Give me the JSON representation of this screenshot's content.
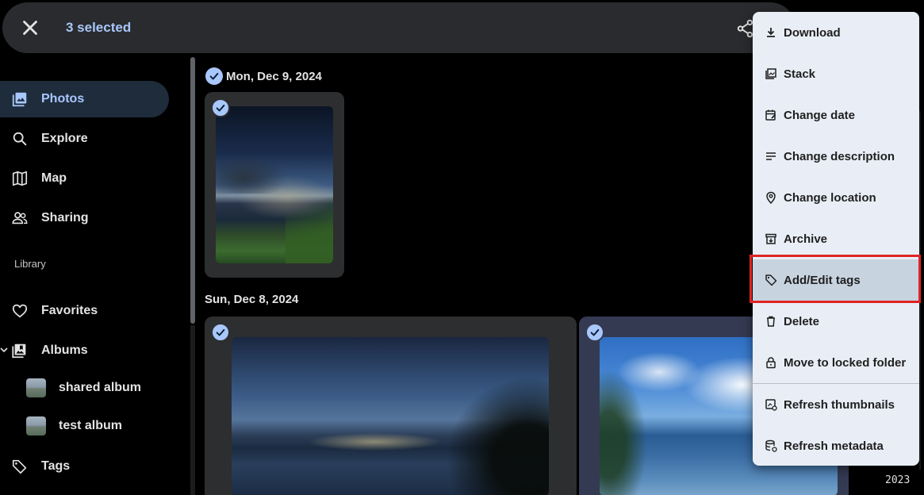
{
  "topbar": {
    "selected_text": "3 selected"
  },
  "sidebar": {
    "items": [
      {
        "label": "Photos",
        "icon": "photos-icon",
        "active": true
      },
      {
        "label": "Explore",
        "icon": "search-icon"
      },
      {
        "label": "Map",
        "icon": "map-icon"
      },
      {
        "label": "Sharing",
        "icon": "people-icon"
      }
    ],
    "library_label": "Library",
    "library_items": [
      {
        "label": "Favorites",
        "icon": "heart-icon"
      },
      {
        "label": "Albums",
        "icon": "album-icon"
      }
    ],
    "albums": [
      {
        "label": "shared album"
      },
      {
        "label": "test album"
      }
    ],
    "tags_label": "Tags"
  },
  "content": {
    "groups": [
      {
        "date": "Mon, Dec 9, 2024"
      },
      {
        "date": "Sun, Dec 8, 2024"
      }
    ]
  },
  "menu": {
    "items": [
      {
        "label": "Download",
        "icon": "download-icon"
      },
      {
        "label": "Stack",
        "icon": "stack-icon"
      },
      {
        "label": "Change date",
        "icon": "calendar-edit-icon"
      },
      {
        "label": "Change description",
        "icon": "description-icon"
      },
      {
        "label": "Change location",
        "icon": "location-icon"
      },
      {
        "label": "Archive",
        "icon": "archive-icon"
      },
      {
        "label": "Add/Edit tags",
        "icon": "tag-icon",
        "highlighted": true
      },
      {
        "label": "Delete",
        "icon": "trash-icon"
      },
      {
        "label": "Move to locked folder",
        "icon": "lock-icon"
      },
      {
        "label": "Refresh thumbnails",
        "icon": "refresh-thumbnails-icon"
      },
      {
        "label": "Refresh metadata",
        "icon": "refresh-metadata-icon"
      }
    ]
  },
  "timeline": {
    "year": "2023"
  },
  "colors": {
    "accent": "#a8c7fa",
    "highlight_box": "#e02424",
    "menu_bg": "#e9eef6"
  }
}
